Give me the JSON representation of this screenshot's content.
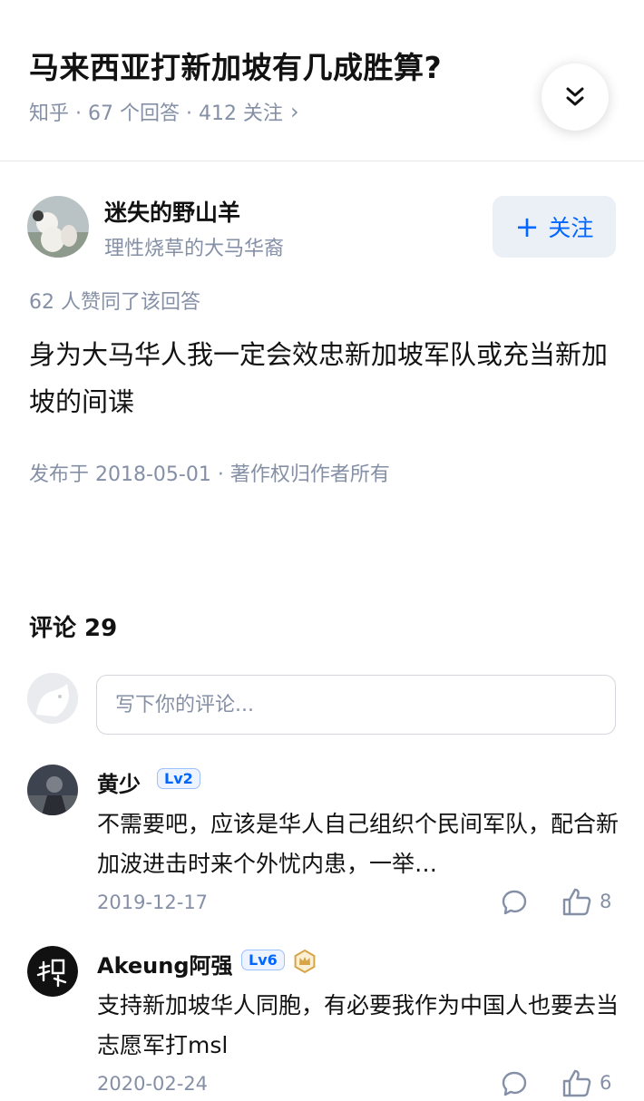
{
  "question": {
    "title": "马来西亚打新加坡有几成胜算?",
    "meta": "知乎 · 67 个回答 · 412 关注",
    "meta_chevron": "›"
  },
  "collapse_icon": "double-chevron-down-icon",
  "author": {
    "name": "迷失的野山羊",
    "bio": "理性烧草的大马华裔",
    "follow_plus": "+",
    "follow_label": "关注"
  },
  "answer": {
    "votes": "62 人赞同了该回答",
    "body": "身为大马华人我一定会效忠新加坡军队或充当新加坡的间谍",
    "publish": "发布于 2018-05-01 · 著作权归作者所有"
  },
  "comments": {
    "title": "评论 29",
    "input_placeholder": "写下你的评论...",
    "items": [
      {
        "user": "黄少",
        "level": "Lv2",
        "text": "不需要吧，应该是华人自己组织个民间军队，配合新加波进击时来个外忧内患，一举…",
        "date": "2019-12-17",
        "likes": "8"
      },
      {
        "user": "Akeung阿强",
        "level": "Lv6",
        "text": "支持新加坡华人同胞，有必要我作为中国人也要去当志愿军打msl",
        "date": "2020-02-24",
        "likes": "6"
      }
    ]
  },
  "colors": {
    "accent": "#0066ff",
    "muted": "#8590a6",
    "follow_bg": "#ebf0f7"
  }
}
